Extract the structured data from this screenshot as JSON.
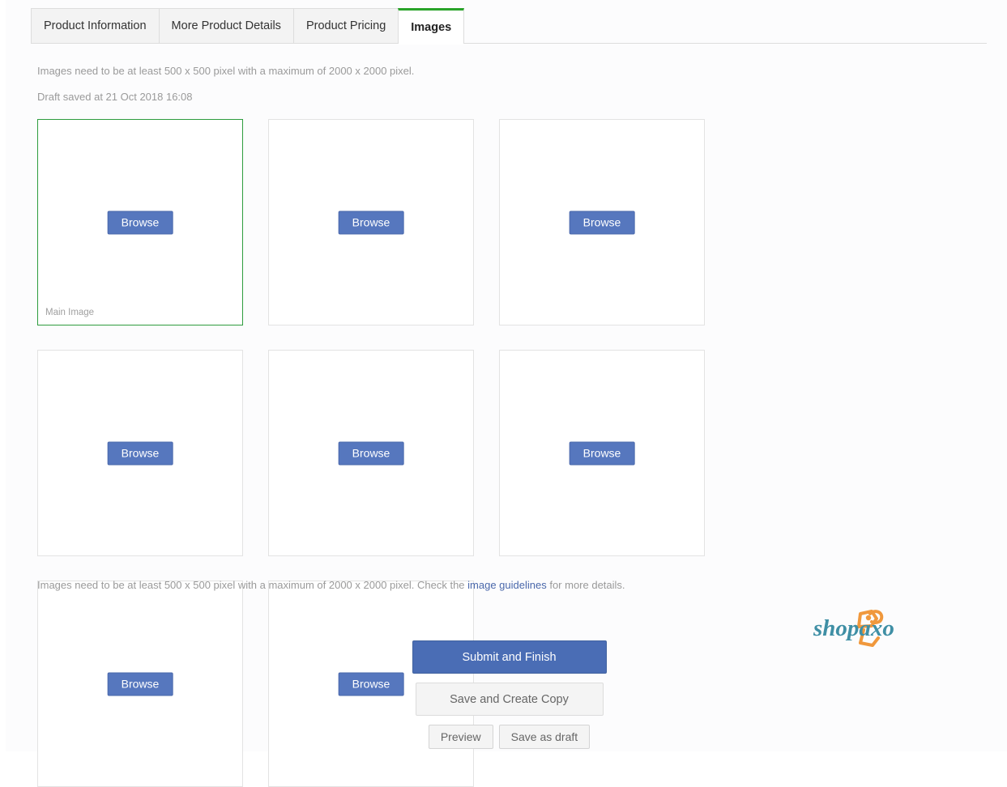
{
  "tabs": [
    {
      "label": "Product Information",
      "active": false
    },
    {
      "label": "More Product Details",
      "active": false
    },
    {
      "label": "Product Pricing",
      "active": false
    },
    {
      "label": "Images",
      "active": true
    }
  ],
  "notices": {
    "top": "Images need to be at least 500 x 500 pixel with a maximum of 2000 x 2000 pixel.",
    "draft_saved": "Draft saved at 21 Oct 2018 16:08",
    "bottom_prefix": "Images need to be at least 500 x 500 pixel with a maximum of 2000 x 2000 pixel. Check the ",
    "bottom_link": "image guidelines",
    "bottom_suffix": " for more details."
  },
  "image_slots": [
    {
      "browse_label": "Browse",
      "caption": "Main Image",
      "is_main": true
    },
    {
      "browse_label": "Browse",
      "caption": "",
      "is_main": false
    },
    {
      "browse_label": "Browse",
      "caption": "",
      "is_main": false
    },
    {
      "browse_label": "Browse",
      "caption": "",
      "is_main": false
    },
    {
      "browse_label": "Browse",
      "caption": "",
      "is_main": false
    },
    {
      "browse_label": "Browse",
      "caption": "",
      "is_main": false
    },
    {
      "browse_label": "Browse",
      "caption": "",
      "is_main": false
    },
    {
      "browse_label": "Browse",
      "caption": "",
      "is_main": false
    }
  ],
  "logo": {
    "text": "shopaxo",
    "text_color": "#3f8fa5",
    "accent_color": "#f0983c"
  },
  "actions": {
    "submit": "Submit and Finish",
    "save_copy": "Save and Create Copy",
    "preview": "Preview",
    "save_draft": "Save as draft"
  },
  "colors": {
    "active_tab_accent": "#29a329",
    "primary_button": "#4a6db5",
    "browse_button": "#5677be",
    "link": "#4a68ab",
    "main_image_border": "#2e9c3e"
  }
}
